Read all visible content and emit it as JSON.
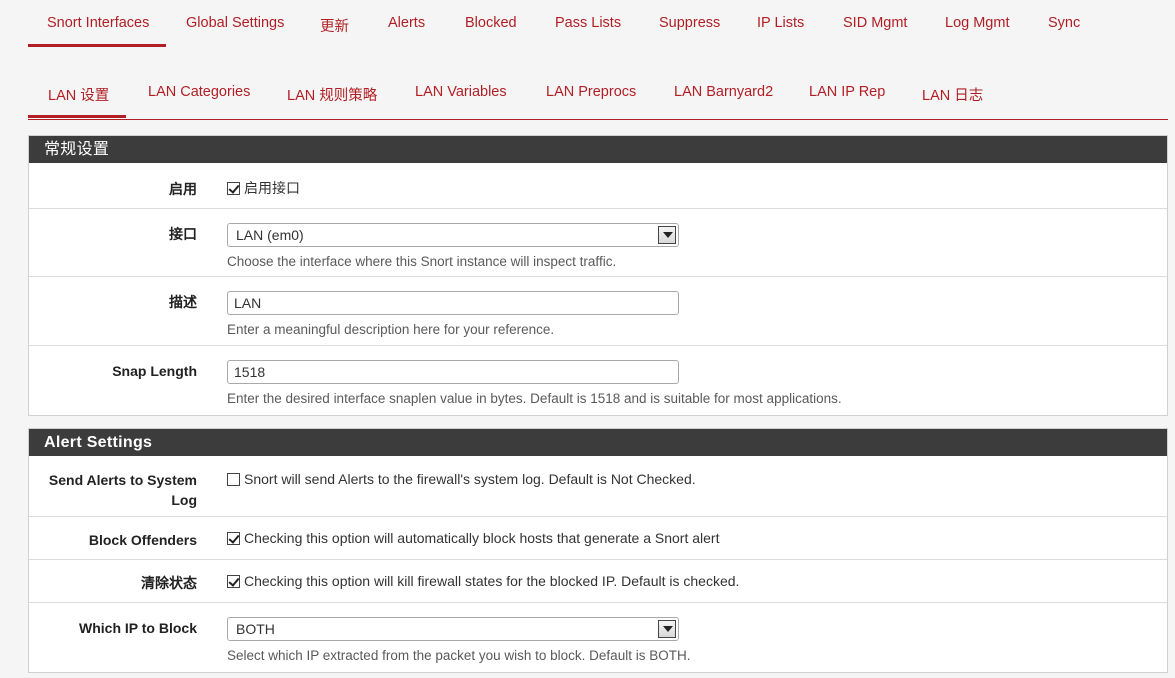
{
  "top_tabs": [
    "Snort Interfaces",
    "Global Settings",
    "更新",
    "Alerts",
    "Blocked",
    "Pass Lists",
    "Suppress",
    "IP Lists",
    "SID Mgmt",
    "Log Mgmt",
    "Sync"
  ],
  "sub_tabs": [
    "LAN 设置",
    "LAN Categories",
    "LAN 规则策略",
    "LAN Variables",
    "LAN Preprocs",
    "LAN Barnyard2",
    "LAN IP Rep",
    "LAN 日志"
  ],
  "general": {
    "heading": "常规设置",
    "enable": {
      "label": "启用",
      "checkbox_label": "启用接口",
      "checked": true
    },
    "interface": {
      "label": "接口",
      "value": "LAN (em0)",
      "help": "Choose the interface where this Snort instance will inspect traffic."
    },
    "description": {
      "label": "描述",
      "value": "LAN",
      "help": "Enter a meaningful description here for your reference."
    },
    "snaplen": {
      "label": "Snap Length",
      "value": "1518",
      "help": "Enter the desired interface snaplen value in bytes. Default is 1518 and is suitable for most applications."
    }
  },
  "alerts": {
    "heading": "Alert Settings",
    "send_alerts": {
      "label_line1": "Send Alerts to System",
      "label_line2": "Log",
      "text": "Snort will send Alerts to the firewall's system log. Default is Not Checked.",
      "checked": false
    },
    "block_offenders": {
      "label": "Block Offenders",
      "text": "Checking this option will automatically block hosts that generate a Snort alert",
      "checked": true
    },
    "kill_states": {
      "label": "清除状态",
      "text": "Checking this option will kill firewall states for the blocked IP. Default is checked.",
      "checked": true
    },
    "which_ip": {
      "label": "Which IP to Block",
      "value": "BOTH",
      "help": "Select which IP extracted from the packet you wish to block. Default is BOTH."
    }
  },
  "colors": {
    "accent": "#b11f25",
    "panel_heading": "#3c3c3c"
  }
}
